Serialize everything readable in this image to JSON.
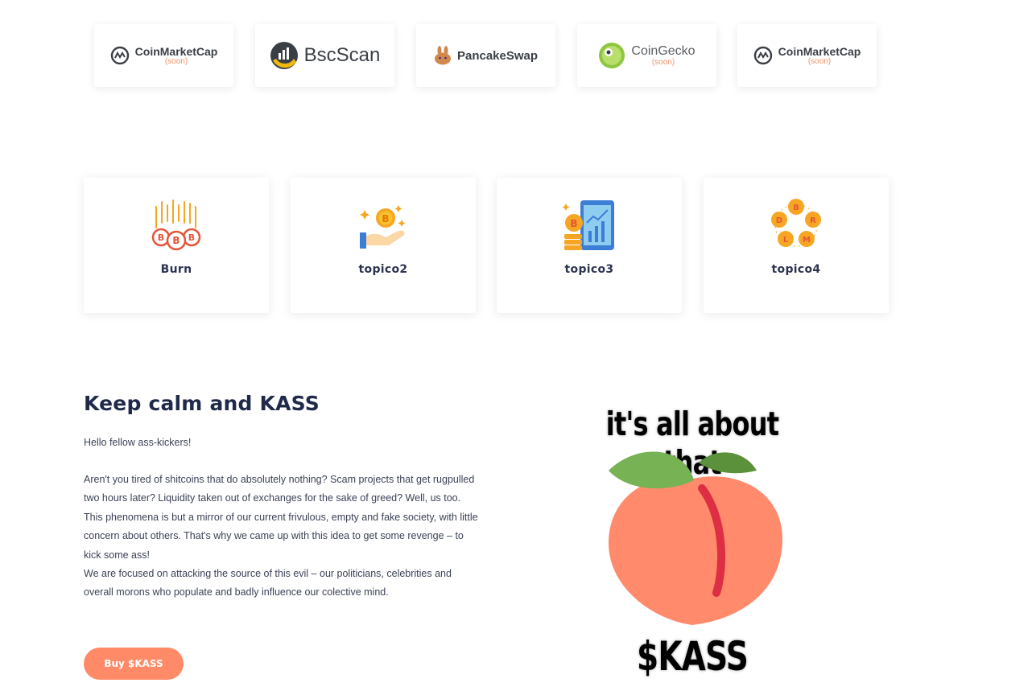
{
  "partners": [
    {
      "name": "CoinMarketCap",
      "note": "(soon)"
    },
    {
      "name": "BscScan",
      "note": ""
    },
    {
      "name": "PancakeSwap",
      "note": ""
    },
    {
      "name": "CoinGecko",
      "note": "(soon)"
    },
    {
      "name": "CoinMarketCap",
      "note": "(soon)"
    }
  ],
  "features": [
    {
      "label": "Burn",
      "icon": "burning-coins-icon"
    },
    {
      "label": "topico2",
      "icon": "hand-coin-icon"
    },
    {
      "label": "topico3",
      "icon": "phone-chart-coins-icon"
    },
    {
      "label": "topico4",
      "icon": "crypto-coins-icon"
    }
  ],
  "about": {
    "title": "Keep calm and KASS",
    "greeting": "Hello fellow ass-kickers!",
    "paragraph1": "Aren't you tired of shitcoins that do absolutely nothing? Scam projects that get rugpulled two hours later? Liquidity taken out of exchanges for the sake of greed? Well, us too.",
    "paragraph2": "This phenomena is but a mirror of our current frivulous, empty and fake society, with little concern about others. That's why we came up with this idea to get some revenge – to kick some ass!",
    "paragraph3": "We are focused on attacking the source of this evil – our politicians, celebrities and overall morons who populate and badly influence our colective mind.",
    "button_label": "Buy $KASS"
  },
  "mascot": {
    "top_text": "it's all about that",
    "bottom_text": "$KASS"
  },
  "colors": {
    "accent": "#fe8a68",
    "heading": "#1f2a4a",
    "peach": "#ff8a6c",
    "leaf": "#6fb04a"
  }
}
